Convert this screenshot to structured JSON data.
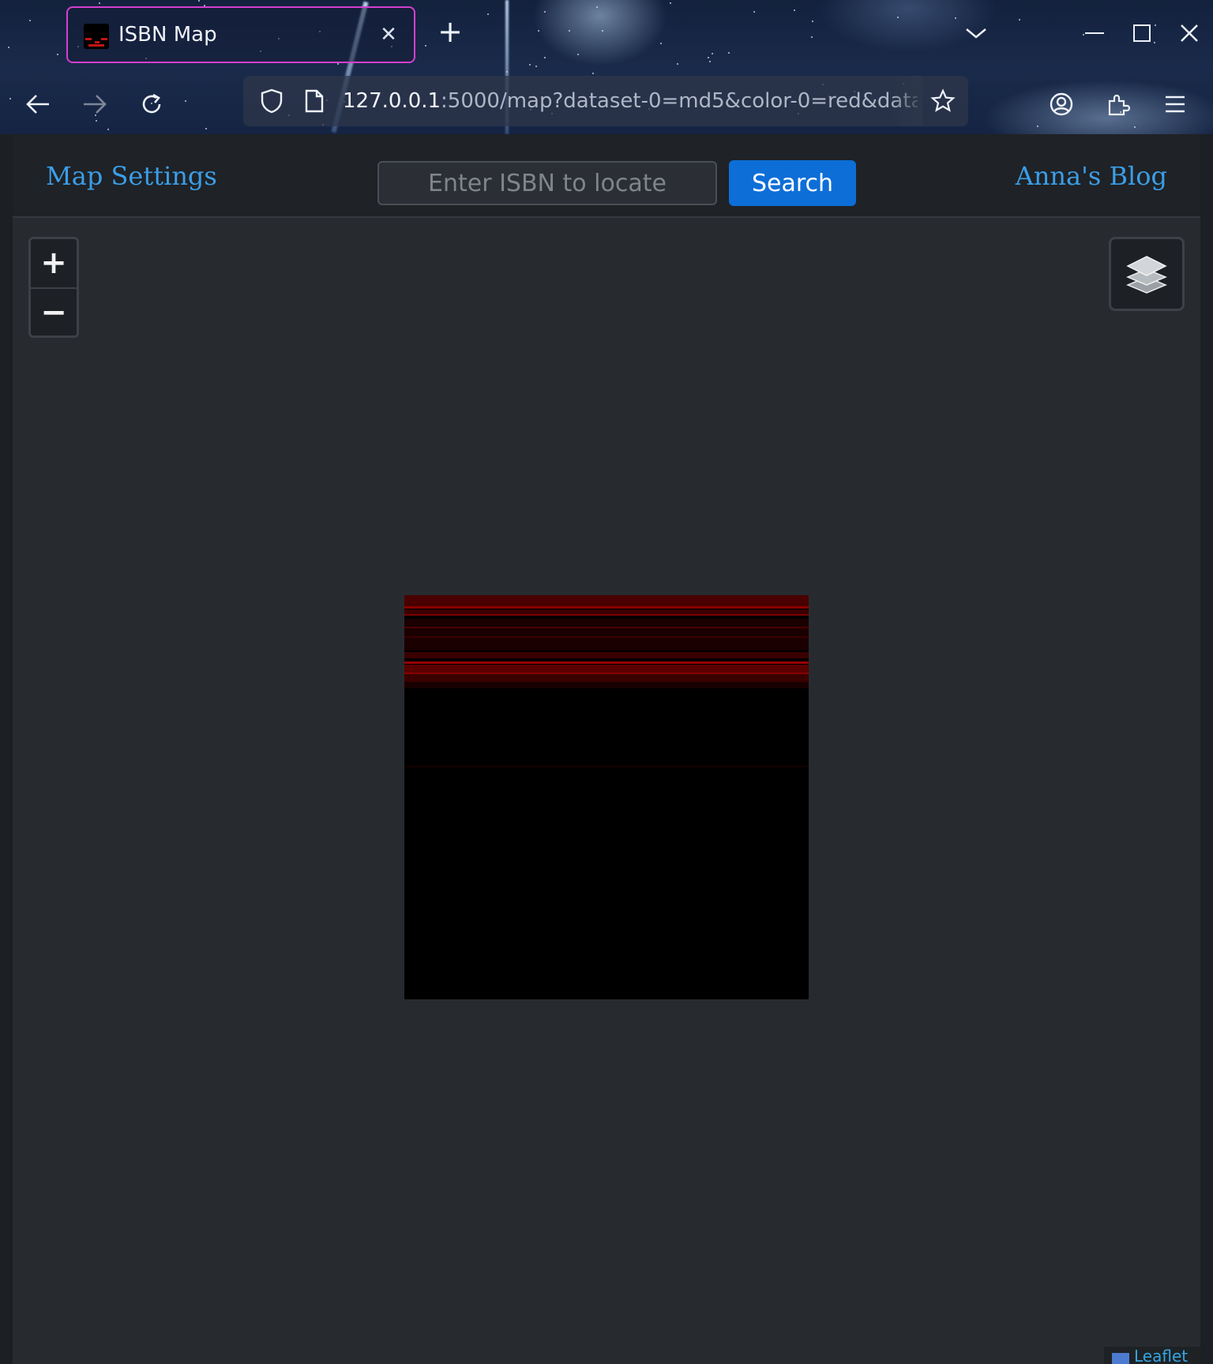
{
  "browser": {
    "tab_title": "ISBN Map",
    "url_host": "127.0.0.1",
    "url_rest": ":5000/map?dataset-0=md5&color-0=red&dataset"
  },
  "header": {
    "map_settings_label": "Map Settings",
    "search_placeholder": "Enter ISBN to locate",
    "search_button_label": "Search",
    "blog_link_label": "Anna's Blog"
  },
  "map": {
    "zoom_in_label": "+",
    "zoom_out_label": "−",
    "attribution": "Leaflet",
    "tile_color": "#c00000",
    "background_color": "#272b30"
  },
  "colors": {
    "link": "#3b9ee8",
    "button": "#0d6ed8",
    "tab_border": "#d43fd0"
  }
}
